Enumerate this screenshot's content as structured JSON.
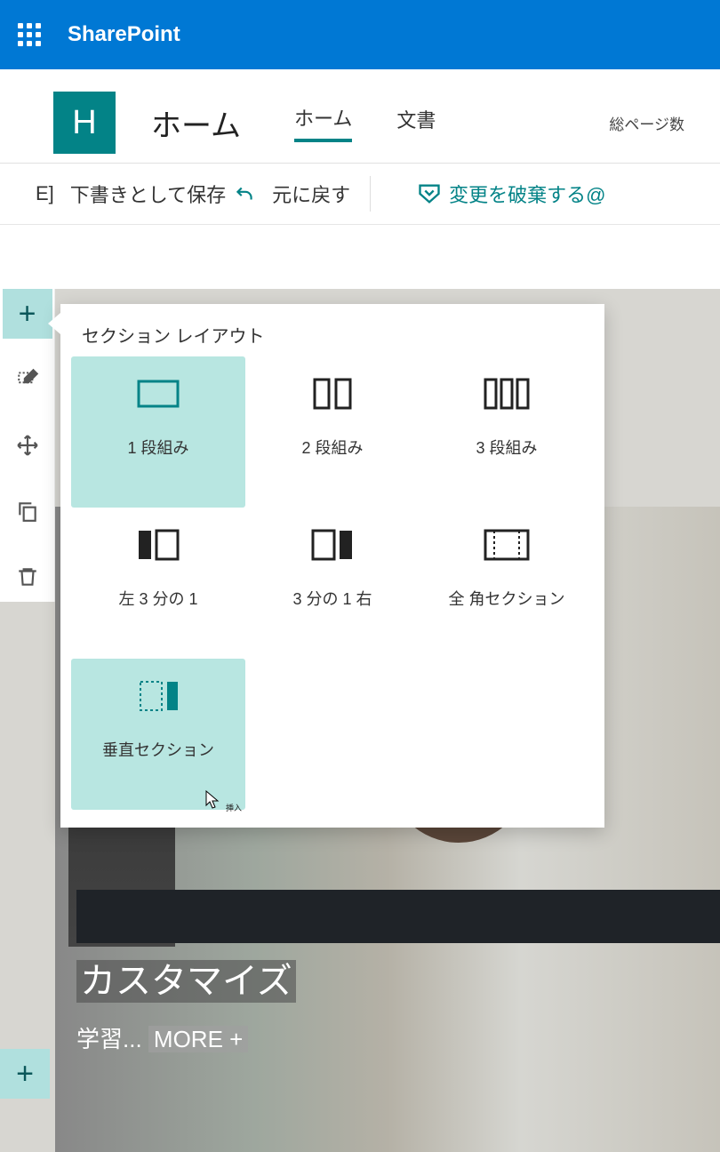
{
  "app": {
    "name": "SharePoint"
  },
  "site": {
    "logoLetter": "H",
    "title": "ホーム"
  },
  "nav": {
    "tabs": [
      {
        "label": "ホーム",
        "active": true
      },
      {
        "label": "文書",
        "active": false
      }
    ],
    "pageCount": "総ページ数"
  },
  "commands": {
    "prefix": "E]",
    "saveDraft": "下書きとして保存",
    "undo": "元に戻す",
    "discard": "変更を破棄する@"
  },
  "sectionFlyout": {
    "title": "セクション レイアウト",
    "options": [
      {
        "key": "one",
        "label": "1 段組み"
      },
      {
        "key": "two",
        "label": "2 段組み"
      },
      {
        "key": "three",
        "label": "3 段組み"
      },
      {
        "key": "leftThird",
        "label": "左 3 分の 1"
      },
      {
        "key": "rightThird",
        "label": "3 分の 1 右"
      },
      {
        "key": "fullWidth",
        "label": "全 角セクション"
      },
      {
        "key": "vertical",
        "label": "垂直セクション"
      }
    ],
    "cursorTooltip": "挿入"
  },
  "hero": {
    "title": "カスタマイズ",
    "subtitle": "学習",
    "moreLabel": "MORE +"
  }
}
